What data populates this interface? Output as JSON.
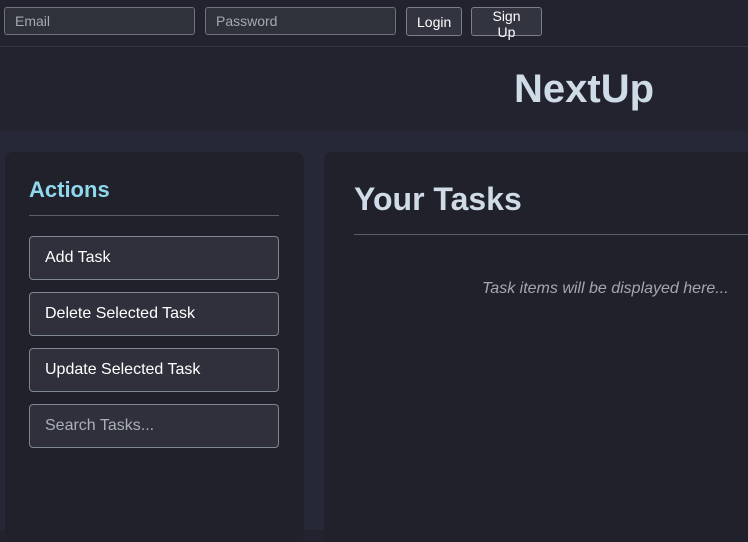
{
  "auth_bar": {
    "email_placeholder": "Email",
    "password_placeholder": "Password",
    "login_label": "Login",
    "signup_label": "Sign Up"
  },
  "header": {
    "title": "NextUp"
  },
  "sidebar": {
    "title": "Actions",
    "buttons": [
      {
        "label": "Add Task"
      },
      {
        "label": "Delete Selected Task"
      },
      {
        "label": "Update Selected Task"
      }
    ],
    "search_placeholder": "Search Tasks..."
  },
  "main": {
    "title": "Your Tasks",
    "empty_text": "Task items will be displayed here..."
  },
  "colors": {
    "background": "#22232f",
    "panel": "#21212c",
    "accent": "#8fd8ee",
    "title_text": "#cfdbe6"
  }
}
